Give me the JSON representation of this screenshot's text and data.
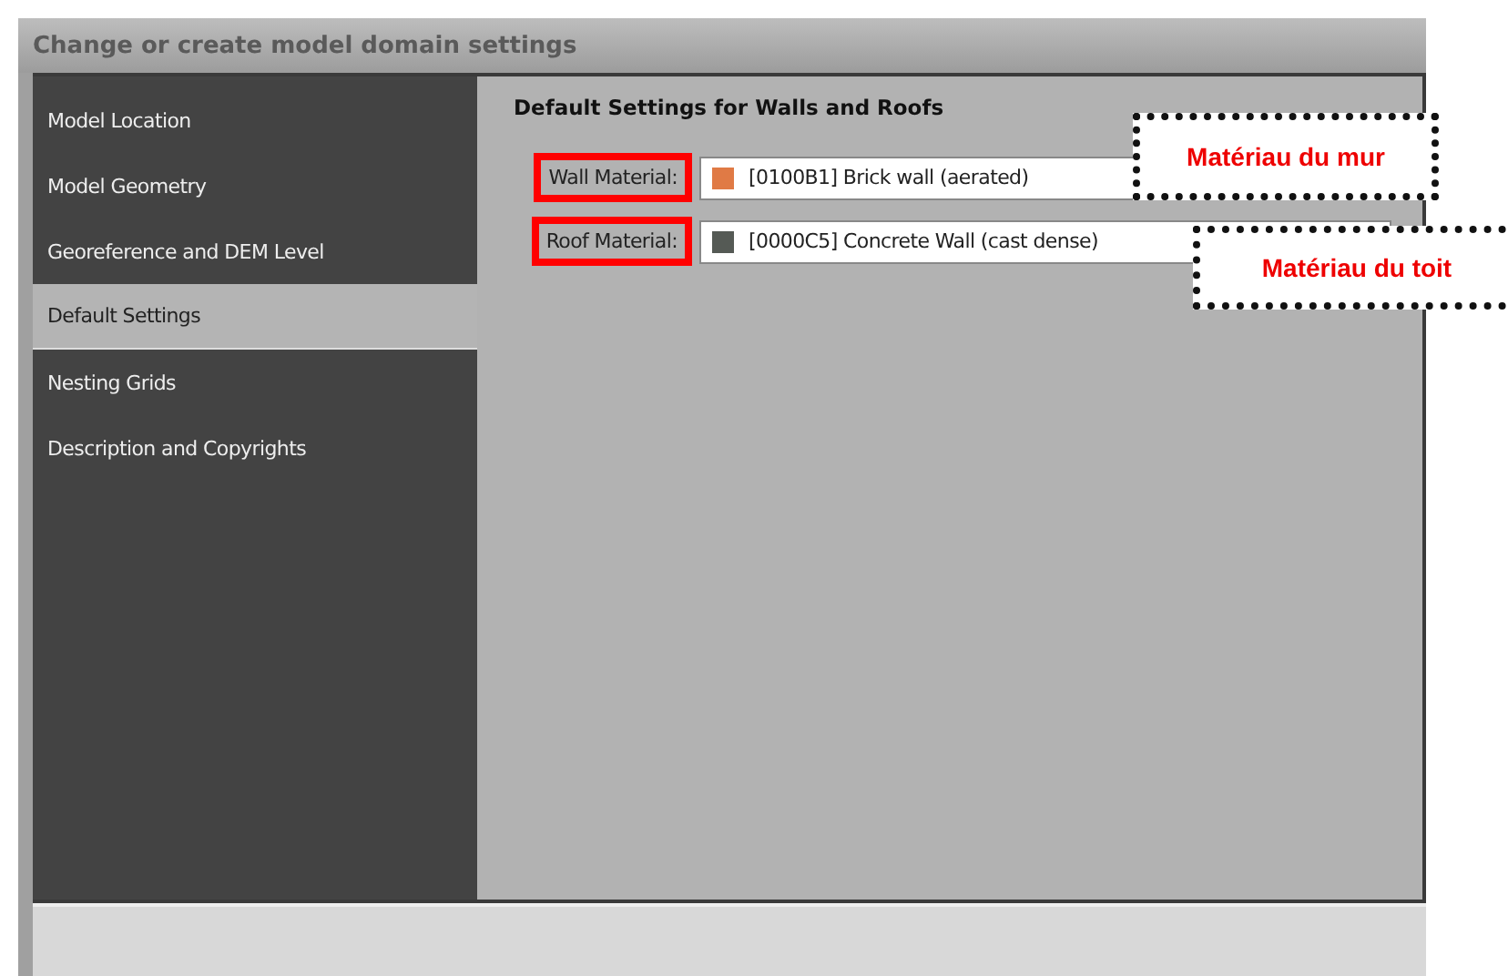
{
  "window": {
    "title": "Change or create model domain settings"
  },
  "sidebar": {
    "items": [
      {
        "label": "Model Location",
        "selected": false
      },
      {
        "label": "Model Geometry",
        "selected": false
      },
      {
        "label": "Georeference and DEM Level",
        "selected": false
      },
      {
        "label": "Default Settings",
        "selected": true
      },
      {
        "label": "Nesting Grids",
        "selected": false
      },
      {
        "label": "Description and Copyrights",
        "selected": false
      }
    ]
  },
  "panel": {
    "title": "Default Settings for Walls and Roofs",
    "fields": [
      {
        "label": "Wall Material:",
        "value": "[0100B1] Brick wall (aerated)",
        "color": "#e07a45",
        "highlighted": true
      },
      {
        "label": "Roof Material:",
        "value": "[0000C5] Concrete Wall (cast dense)",
        "color": "#555a55",
        "highlighted": true
      }
    ]
  },
  "annotations": [
    {
      "text": "Matériau du mur"
    },
    {
      "text": "Matériau du toit"
    }
  ]
}
